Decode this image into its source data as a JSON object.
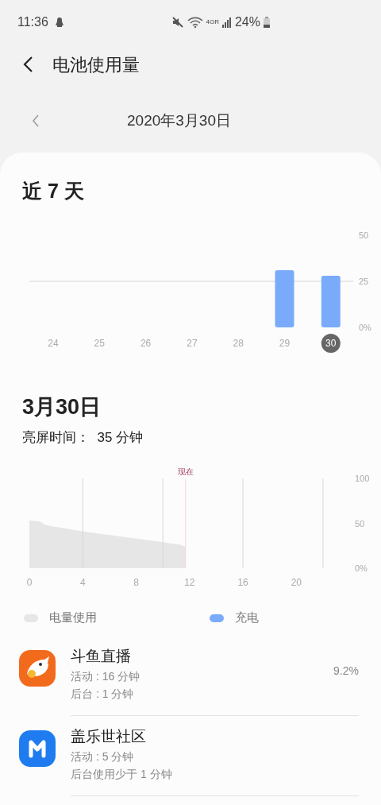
{
  "status_bar": {
    "time": "11:36",
    "network": "4GR",
    "battery": "24%"
  },
  "header": {
    "title": "电池使用量"
  },
  "date_nav": {
    "date": "2020年3月30日"
  },
  "week": {
    "title": "近 7 天",
    "chart_data": {
      "type": "bar",
      "categories": [
        "24",
        "25",
        "26",
        "27",
        "28",
        "29",
        "30"
      ],
      "series": [
        {
          "name": "充电",
          "color": "#7aabfb",
          "values": [
            null,
            null,
            null,
            null,
            null,
            31,
            28
          ]
        }
      ],
      "ylim": [
        0,
        50
      ],
      "yticks": [
        {
          "value": 0,
          "label": "0%"
        },
        25,
        50
      ]
    },
    "days": [
      {
        "selected": false
      },
      {
        "selected": false
      },
      {
        "selected": false
      },
      {
        "selected": false
      },
      {
        "selected": false
      },
      {
        "selected": false
      },
      {
        "selected": true
      }
    ]
  },
  "day": {
    "title": "3月30日",
    "screen_time": "亮屏时间：  35 分钟",
    "chart_data": {
      "type": "area",
      "x": [
        0,
        0.8,
        1.2,
        2,
        4,
        6,
        8,
        10,
        11.3,
        11.7
      ],
      "series": [
        {
          "name": "电量使用",
          "color": "#e6e6e6",
          "values": [
            53,
            52,
            48,
            46,
            41,
            37,
            33,
            29,
            26,
            24
          ]
        }
      ],
      "xlim": [
        0,
        22
      ],
      "ylim": [
        0,
        100
      ],
      "xticks": [
        0,
        4,
        8,
        12,
        16,
        20
      ],
      "yticks": [
        {
          "value": 0,
          "label": "0%"
        },
        50,
        100
      ],
      "ref_lines": [
        {
          "axis": "x",
          "value": 11.7,
          "label": "现在"
        }
      ]
    }
  },
  "apps": [
    {
      "name": "斗鱼直播",
      "kind": "fish",
      "lines": [
        "活动 : 16 分钟",
        "后台 : 1 分钟"
      ],
      "percent": "9.2%"
    },
    {
      "name": "盖乐世社区",
      "kind": "m",
      "lines": [
        "活动 : 5 分钟",
        "后台使用少于 1 分钟"
      ]
    }
  ]
}
